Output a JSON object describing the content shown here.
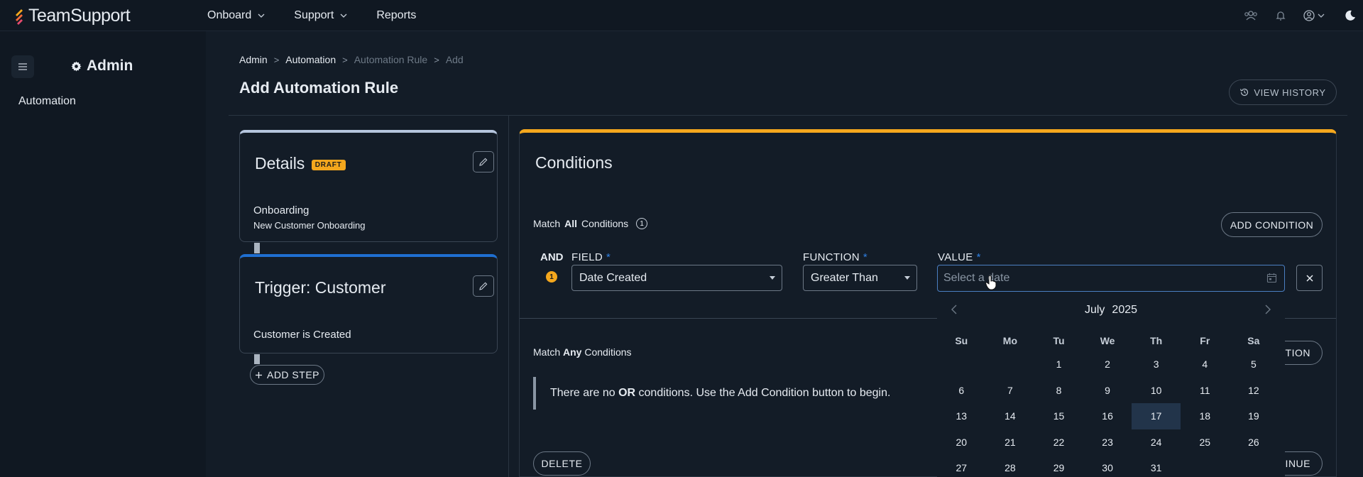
{
  "app": {
    "logo_text": "TeamSupport"
  },
  "topnav": {
    "items": [
      {
        "label": "Onboard",
        "has_menu": true
      },
      {
        "label": "Support",
        "has_menu": true
      },
      {
        "label": "Reports",
        "has_menu": false
      }
    ]
  },
  "sidebar": {
    "title": "Admin",
    "items": [
      {
        "label": "Automation"
      }
    ]
  },
  "breadcrumb": [
    "Admin",
    "Automation",
    "Automation Rule",
    "Add"
  ],
  "page": {
    "title": "Add Automation Rule",
    "view_history": "VIEW HISTORY"
  },
  "steps": {
    "details": {
      "title": "Details",
      "badge": "DRAFT",
      "line1": "Onboarding",
      "line2": "New Customer Onboarding"
    },
    "trigger": {
      "title": "Trigger: Customer",
      "line1": "Customer is Created"
    },
    "add_step": "ADD STEP"
  },
  "conditions": {
    "title": "Conditions",
    "match_all_prefix": "Match",
    "match_all_bold": "All",
    "match_all_suffix": "Conditions",
    "match_all_count": "1",
    "add_condition": "ADD CONDITION",
    "row": {
      "and_label": "AND",
      "index": "1",
      "field_label": "FIELD",
      "field_value": "Date Created",
      "function_label": "FUNCTION",
      "function_value": "Greater Than",
      "value_label": "VALUE",
      "value_placeholder": "Select a date"
    },
    "match_any_prefix": "Match",
    "match_any_bold": "Any",
    "match_any_suffix": "Conditions",
    "info_pre": "There are no",
    "info_bold": "OR",
    "info_post": "conditions. Use the Add Condition button to begin.",
    "add_condition_any_partial": "TION",
    "delete": "DELETE",
    "continue_partial": "TINUE"
  },
  "calendar": {
    "month": "July",
    "year": "2025",
    "weekdays": [
      "Su",
      "Mo",
      "Tu",
      "We",
      "Th",
      "Fr",
      "Sa"
    ],
    "leading_blanks": 2,
    "visible_days": 31,
    "selected_day": 17
  },
  "colors": {
    "accent_orange": "#f4a71d",
    "accent_blue": "#1f6fd1",
    "required_star": "#2f7fe0",
    "background": "#131c27"
  }
}
